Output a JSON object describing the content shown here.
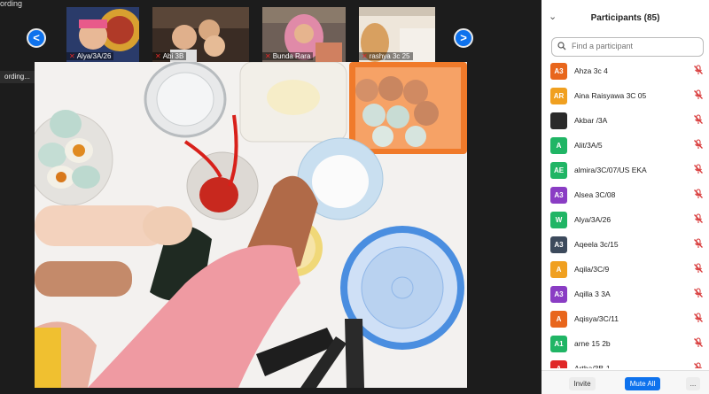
{
  "app": {
    "top_text": "ording"
  },
  "strip": {
    "prev_label": "<",
    "next_label": ">",
    "thumbnails": [
      {
        "name": "Alya/3A/26",
        "bg": "#c9b48a"
      },
      {
        "name": "Abi 3B",
        "bg": "#4a3a30"
      },
      {
        "name": "Bunda Rara",
        "bg": "#6b5a50"
      },
      {
        "name": "rashya 3c 25",
        "bg": "#c8a26a"
      }
    ]
  },
  "recording": {
    "label": "ording..."
  },
  "participants": {
    "title": "Participants (85)",
    "search_placeholder": "Find a participant",
    "list": [
      {
        "initials": "A3",
        "name": "Ahza 3c 4",
        "color": "#e8661c"
      },
      {
        "initials": "AR",
        "name": "Aina Raisyawa 3C 05",
        "color": "#f0a020"
      },
      {
        "initials": "",
        "name": "Akbar /3A",
        "color": "#2a2a2a"
      },
      {
        "initials": "A",
        "name": "Alit/3A/5",
        "color": "#20b565"
      },
      {
        "initials": "AE",
        "name": "almira/3C/07/US EKA",
        "color": "#20b565"
      },
      {
        "initials": "A3",
        "name": "Alsea 3C/08",
        "color": "#8a3dc4"
      },
      {
        "initials": "W",
        "name": "Alya/3A/26",
        "color": "#20b565"
      },
      {
        "initials": "A3",
        "name": "Aqeela 3c/15",
        "color": "#3c4a5c"
      },
      {
        "initials": "A",
        "name": "Aqila/3C/9",
        "color": "#f0a020"
      },
      {
        "initials": "A3",
        "name": "Aqilla 3 3A",
        "color": "#8a3dc4"
      },
      {
        "initials": "A",
        "name": "Aqisya/3C/11",
        "color": "#e8661c"
      },
      {
        "initials": "A1",
        "name": "arne 15 2b",
        "color": "#20b565"
      },
      {
        "initials": "A",
        "name": "Artha/3B-1",
        "color": "#e02828"
      }
    ],
    "invite_label": "Invite",
    "mute_all_label": "Mute All",
    "more_label": "..."
  }
}
